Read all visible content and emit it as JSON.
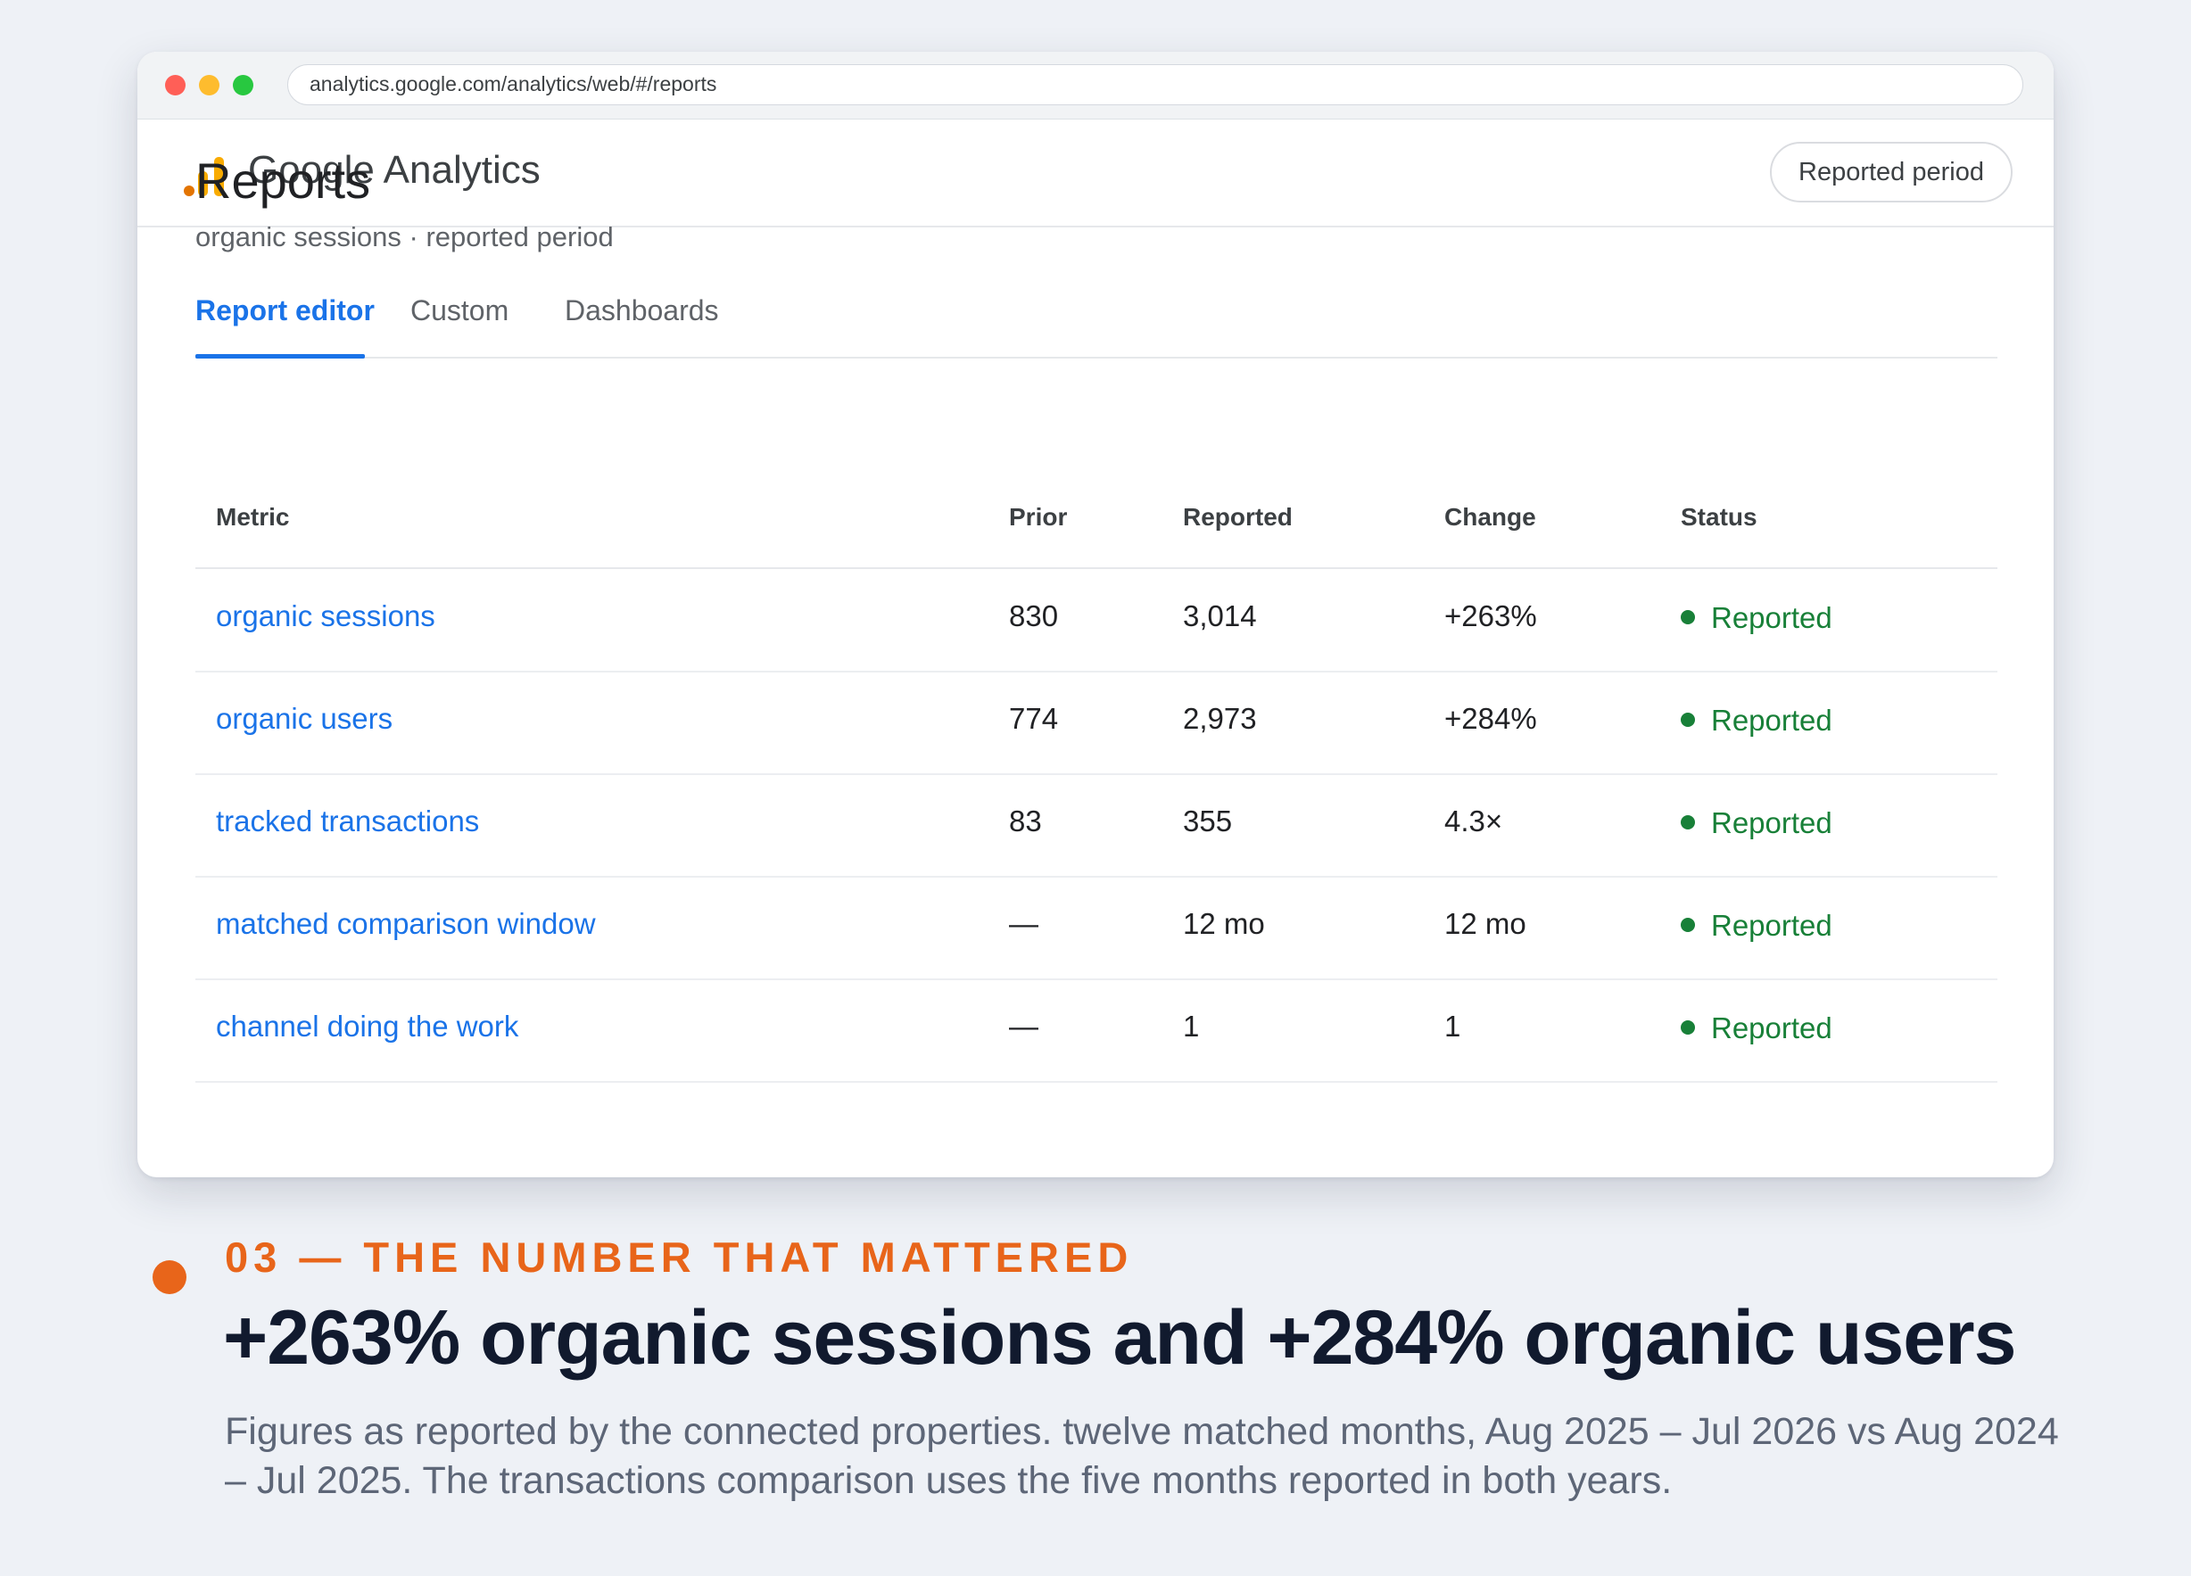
{
  "browser": {
    "url": "analytics.google.com/analytics/web/#/reports"
  },
  "app": {
    "title": "Google Analytics",
    "period_button": "Reported period"
  },
  "page": {
    "title": "Reports",
    "subtitle": "organic sessions · reported period"
  },
  "tabs": [
    {
      "label": "Report editor",
      "active": true
    },
    {
      "label": "Custom",
      "active": false
    },
    {
      "label": "Dashboards",
      "active": false
    }
  ],
  "table": {
    "headers": [
      "Metric",
      "Prior",
      "Reported",
      "Change",
      "Status"
    ],
    "rows": [
      {
        "metric": "organic sessions",
        "prior": "830",
        "reported": "3,014",
        "change": "+263%",
        "status": "Reported"
      },
      {
        "metric": "organic users",
        "prior": "774",
        "reported": "2,973",
        "change": "+284%",
        "status": "Reported"
      },
      {
        "metric": "tracked transactions",
        "prior": "83",
        "reported": "355",
        "change": "4.3×",
        "status": "Reported"
      },
      {
        "metric": "matched comparison window",
        "prior": "—",
        "reported": "12 mo",
        "change": "12 mo",
        "status": "Reported"
      },
      {
        "metric": "channel doing the work",
        "prior": "—",
        "reported": "1",
        "change": "1",
        "status": "Reported"
      }
    ]
  },
  "caption": {
    "eyebrow": "03 — THE NUMBER THAT MATTERED",
    "headline": "+263% organic sessions and +284% organic users",
    "body": "Figures as reported by the connected properties. twelve matched months, Aug 2025 – Jul 2026 vs Aug 2024 – Jul 2025. The transactions comparison uses the five months reported in both years."
  },
  "colors": {
    "accent_blue": "#1a73e8",
    "status_green": "#188038",
    "caption_orange": "#e8651a",
    "headline_navy": "#111a2e"
  },
  "icons": [
    "google-analytics-logo-icon",
    "status-dot-icon",
    "window-close-icon",
    "window-minimize-icon",
    "window-maximize-icon"
  ]
}
